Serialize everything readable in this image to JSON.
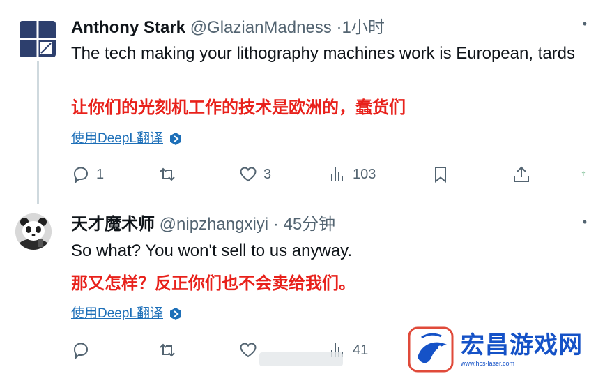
{
  "tweets": [
    {
      "name": "Anthony Stark",
      "handle": "@GlazianMadness",
      "separator": "·",
      "time": "1小时",
      "text": "The tech making your lithography machines work is European, tards",
      "translation": "让你们的光刻机工作的技术是欧洲的，蠢货们",
      "translate_link": "使用DeepL翻译",
      "actions": {
        "replies": "1",
        "retweets": "",
        "likes": "3",
        "views": "103",
        "bookmark": "",
        "share": ""
      }
    },
    {
      "name": "天才魔术师",
      "handle": "@nipzhangxiyi",
      "separator": "·",
      "time": "45分钟",
      "text": "So what? You won't sell to us anyway.",
      "translation": "那又怎样？反正你们也不会卖给我们。",
      "translate_link": "使用DeepL翻译",
      "actions": {
        "replies": "",
        "retweets": "",
        "likes": "",
        "views": "41"
      }
    }
  ],
  "watermark": {
    "title": "宏昌游戏网",
    "url": "www.hcs-laser.com"
  },
  "colors": {
    "translation": "#e8211b",
    "link": "#1d6fb8",
    "muted": "#536471",
    "watermark": "#1552c7"
  }
}
